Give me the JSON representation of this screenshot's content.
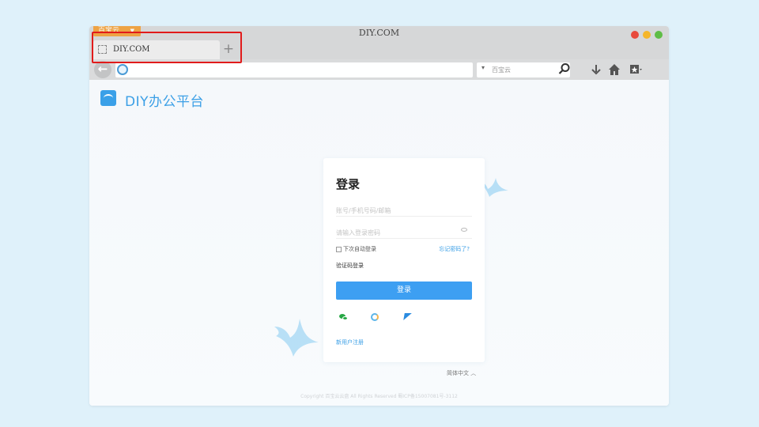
{
  "browser": {
    "app_menu_label": "百宝云",
    "window_title": "DIY.COM",
    "traffic_colors": [
      "#e84a3d",
      "#f5b62b",
      "#5fbd46"
    ],
    "tab": {
      "label": "DIY.COM"
    },
    "new_tab_label": "+",
    "url_value": "",
    "search_placeholder": "百宝云"
  },
  "page": {
    "brand_name": "DIY办公平台",
    "login": {
      "title": "登录",
      "account_placeholder": "账号/手机号码/邮箱",
      "password_placeholder": "请输入登录密码",
      "remember_label": "下次自动登录",
      "forgot_label": "忘记密码了?",
      "code_login_label": "验证码登录",
      "submit_label": "登录",
      "register_label": "新用户注册",
      "social_icons": [
        "wechat-icon",
        "qq-icon",
        "feishu-icon"
      ]
    },
    "language_label": "简体中文 ︿",
    "footer_text": "Copyright 百宝云云盘 All Rights Reserved 蜀ICP备15007081号-3112"
  },
  "annotation": {
    "highlight_color": "#e11b1b"
  }
}
